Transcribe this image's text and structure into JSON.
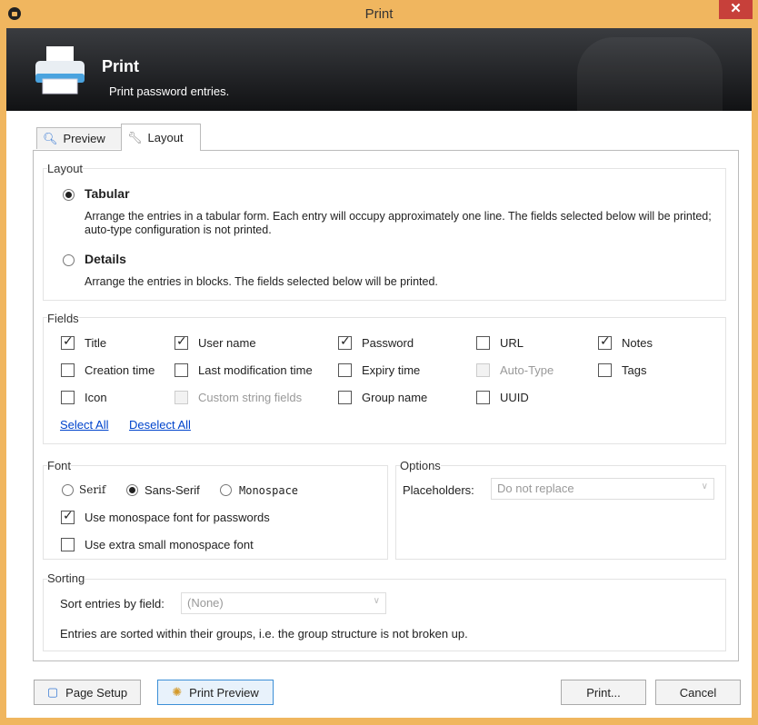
{
  "window": {
    "title": "Print",
    "close": "✕"
  },
  "banner": {
    "title": "Print",
    "subtitle": "Print password entries."
  },
  "tabs": [
    {
      "label": "Preview",
      "icon": "magnifier-icon"
    },
    {
      "label": "Layout",
      "icon": "wrench-icon"
    }
  ],
  "layout_group": {
    "legend": "Layout",
    "tabular": {
      "label": "Tabular",
      "desc": "Arrange the entries in a tabular form. Each entry will occupy approximately one line. The fields selected below will be printed; auto-type configuration is not printed.",
      "selected": true
    },
    "details": {
      "label": "Details",
      "desc": "Arrange the entries in blocks. The fields selected below will be printed.",
      "selected": false
    }
  },
  "fields_group": {
    "legend": "Fields",
    "items": [
      {
        "label": "Title",
        "checked": true,
        "enabled": true
      },
      {
        "label": "User name",
        "checked": true,
        "enabled": true
      },
      {
        "label": "Password",
        "checked": true,
        "enabled": true
      },
      {
        "label": "URL",
        "checked": false,
        "enabled": true
      },
      {
        "label": "Notes",
        "checked": true,
        "enabled": true
      },
      {
        "label": "Creation time",
        "checked": false,
        "enabled": true
      },
      {
        "label": "Last modification time",
        "checked": false,
        "enabled": true
      },
      {
        "label": "Expiry time",
        "checked": false,
        "enabled": true
      },
      {
        "label": "Auto-Type",
        "checked": false,
        "enabled": false
      },
      {
        "label": "Tags",
        "checked": false,
        "enabled": true
      },
      {
        "label": "Icon",
        "checked": false,
        "enabled": true
      },
      {
        "label": "Custom string fields",
        "checked": false,
        "enabled": false
      },
      {
        "label": "Group name",
        "checked": false,
        "enabled": true
      },
      {
        "label": "UUID",
        "checked": false,
        "enabled": true
      }
    ],
    "select_all": "Select All",
    "deselect_all": "Deselect All"
  },
  "font_group": {
    "legend": "Font",
    "serif": "Serif",
    "sans": "Sans-Serif",
    "mono": "Monospace",
    "selected": "Sans-Serif",
    "mono_passwords": {
      "label": "Use monospace font for passwords",
      "checked": true
    },
    "extra_small": {
      "label": "Use extra small monospace font",
      "checked": false
    }
  },
  "options_group": {
    "legend": "Options",
    "placeholders_label": "Placeholders:",
    "placeholders_value": "Do not replace"
  },
  "sorting_group": {
    "legend": "Sorting",
    "sort_label": "Sort entries by field:",
    "sort_value": "(None)",
    "note": "Entries are sorted within their groups, i.e. the group structure is not broken up."
  },
  "buttons": {
    "page_setup": "Page Setup",
    "print_preview": "Print Preview",
    "print": "Print...",
    "cancel": "Cancel"
  }
}
